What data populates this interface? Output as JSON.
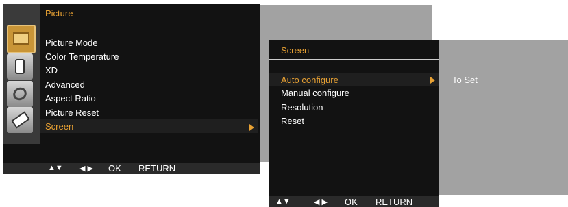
{
  "main_menu": {
    "title": "Picture",
    "items": [
      {
        "label": "Picture Mode"
      },
      {
        "label": "Color Temperature"
      },
      {
        "label": "XD"
      },
      {
        "label": "Advanced"
      },
      {
        "label": "Aspect Ratio"
      },
      {
        "label": "Picture Reset"
      },
      {
        "label": "Screen",
        "selected": true
      }
    ],
    "side_icons": [
      "picture-icon",
      "sound-icon",
      "time-icon",
      "setup-icon"
    ],
    "footer": {
      "nav_updown": "▲▼",
      "nav_leftright": "◀ ▶",
      "ok": "OK",
      "return": "RETURN"
    }
  },
  "sub_menu": {
    "title": "Screen",
    "items": [
      {
        "label": "Auto configure",
        "selected": true
      },
      {
        "label": "Manual configure"
      },
      {
        "label": "Resolution"
      },
      {
        "label": "Reset"
      }
    ],
    "value_label": "To Set",
    "footer": {
      "nav_updown": "▲▼",
      "nav_leftright": "◀ ▶",
      "ok": "OK",
      "return": "RETURN"
    }
  },
  "colors": {
    "accent": "#e8a133",
    "menu_bg": "#121212",
    "panel_grey": "#a2a2a2"
  }
}
